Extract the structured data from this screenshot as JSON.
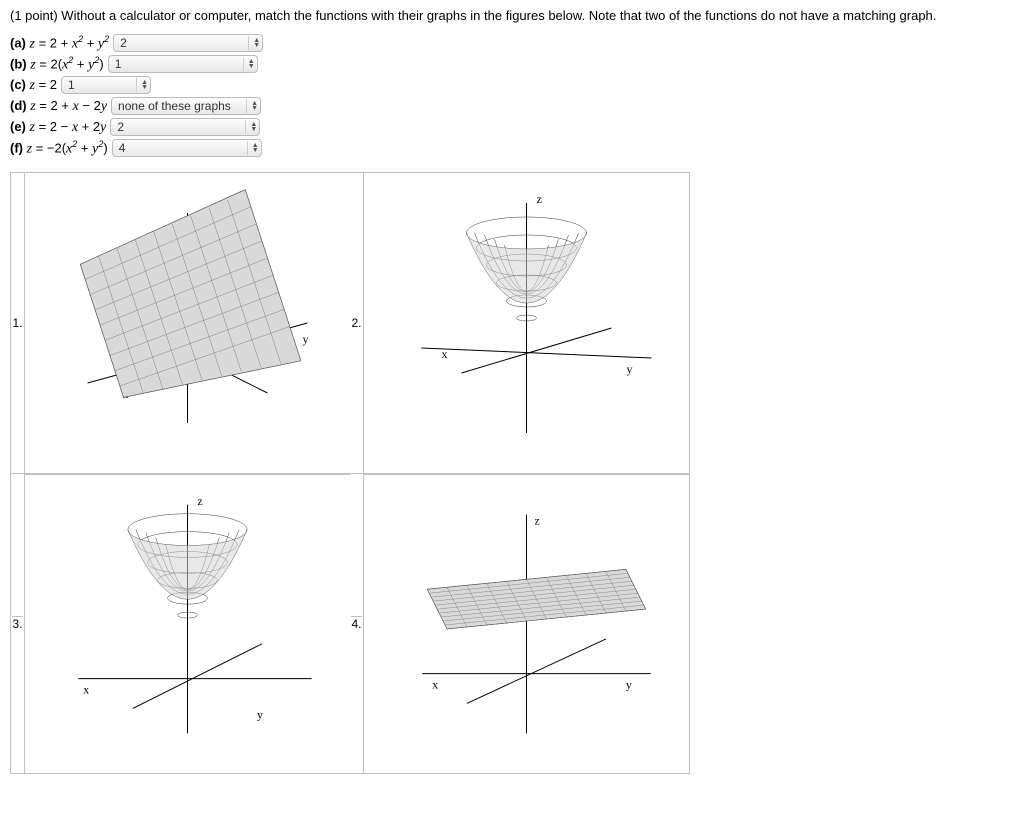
{
  "prompt": "(1 point) Without a calculator or computer, match the functions with their graphs in the figures below. Note that two of the functions do not have a matching graph.",
  "options": {
    "a": {
      "label": "(a)",
      "value": "2"
    },
    "b": {
      "label": "(b)",
      "value": "1"
    },
    "c": {
      "label": "(c)",
      "value": "1"
    },
    "d": {
      "label": "(d)",
      "value": "none of these graphs"
    },
    "e": {
      "label": "(e)",
      "value": "2"
    },
    "f": {
      "label": "(f)",
      "value": "4"
    }
  },
  "figures": {
    "n1": "1.",
    "n2": "2.",
    "n3": "3.",
    "n4": "4."
  },
  "axis": {
    "x": "x",
    "y": "y",
    "z": "z"
  }
}
